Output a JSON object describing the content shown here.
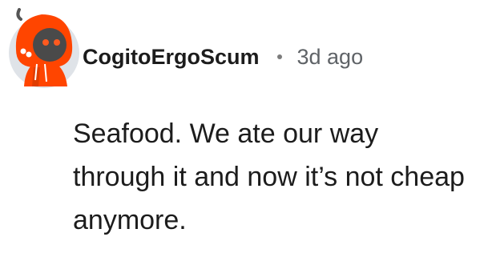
{
  "comment": {
    "author": "CogitoErgoScum",
    "separator": "·",
    "timestamp": "3d ago",
    "body": "Seafood. We ate our way through it and now it’s not cheap anymore.",
    "avatar_icon": "snoo-avatar-orange-hoodie"
  },
  "colors": {
    "avatar_background": "#dfe3e8",
    "hoodie": "#ff4500",
    "username": "#1c1c1c",
    "timestamp": "#5f6367",
    "body_text": "#1c1c1c"
  }
}
